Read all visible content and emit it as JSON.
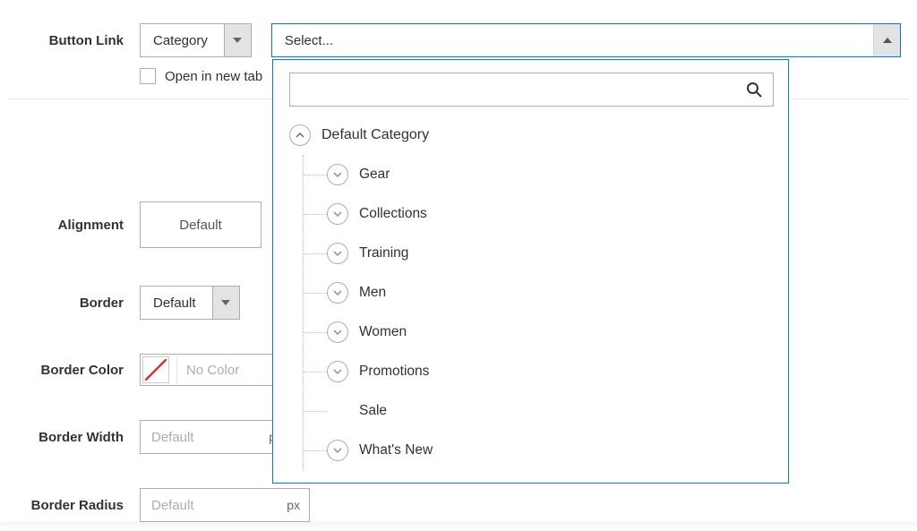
{
  "button_link": {
    "label": "Button Link",
    "type_value": "Category",
    "select_placeholder": "Select...",
    "open_tab_label": "Open in new tab"
  },
  "alignment": {
    "label": "Alignment",
    "value": "Default"
  },
  "border": {
    "label": "Border",
    "value": "Default"
  },
  "border_color": {
    "label": "Border Color",
    "placeholder": "No Color"
  },
  "border_width": {
    "label": "Border Width",
    "placeholder": "Default",
    "unit": "px"
  },
  "border_radius": {
    "label": "Border Radius",
    "placeholder": "Default",
    "unit": "px"
  },
  "tree": {
    "root": "Default Category",
    "items": [
      "Gear",
      "Collections",
      "Training",
      "Men",
      "Women",
      "Promotions",
      "Sale",
      "What's New"
    ]
  }
}
